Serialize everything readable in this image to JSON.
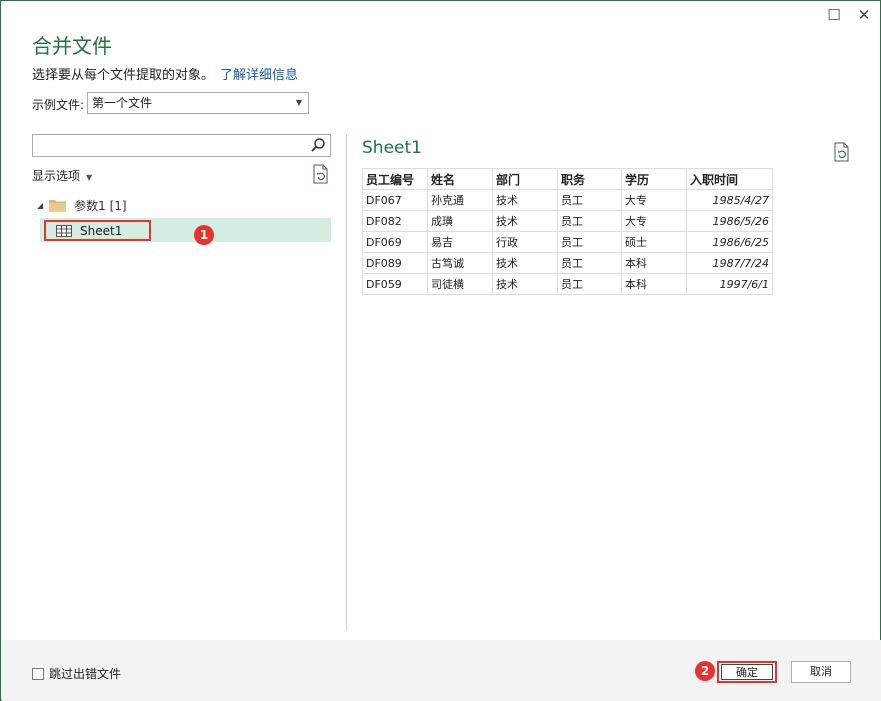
{
  "window": {
    "maximize_icon": "maximize-icon",
    "close_icon": "close-icon"
  },
  "header": {
    "title": "合并文件",
    "subtitle": "选择要从每个文件提取的对象。",
    "learn_more": "了解详细信息"
  },
  "sample": {
    "label": "示例文件:",
    "selected": "第一个文件"
  },
  "navigator": {
    "search_placeholder": "",
    "display_options": "显示选项",
    "folder_label": "参数1 [1]",
    "sheet_label": "Sheet1"
  },
  "preview": {
    "title": "Sheet1",
    "columns": [
      "员工编号",
      "姓名",
      "部门",
      "职务",
      "学历",
      "入职时间"
    ],
    "rows": [
      [
        "DF067",
        "孙克通",
        "技术",
        "员工",
        "大专",
        "1985/4/27"
      ],
      [
        "DF082",
        "成璜",
        "技术",
        "员工",
        "大专",
        "1986/5/26"
      ],
      [
        "DF069",
        "易吉",
        "行政",
        "员工",
        "硕士",
        "1986/6/25"
      ],
      [
        "DF089",
        "古笃诚",
        "技术",
        "员工",
        "本科",
        "1987/7/24"
      ],
      [
        "DF059",
        "司徒横",
        "技术",
        "员工",
        "本科",
        "1997/6/1"
      ]
    ]
  },
  "annotations": {
    "badge1": "1",
    "badge2": "2"
  },
  "footer": {
    "skip_label": "跳过出错文件",
    "skip_checked": false,
    "ok_label": "确定",
    "cancel_label": "取消"
  },
  "colors": {
    "accent": "#217346",
    "highlight_box": "#e8322e",
    "selected_row": "#d3ede0",
    "link": "#1a5da8"
  }
}
